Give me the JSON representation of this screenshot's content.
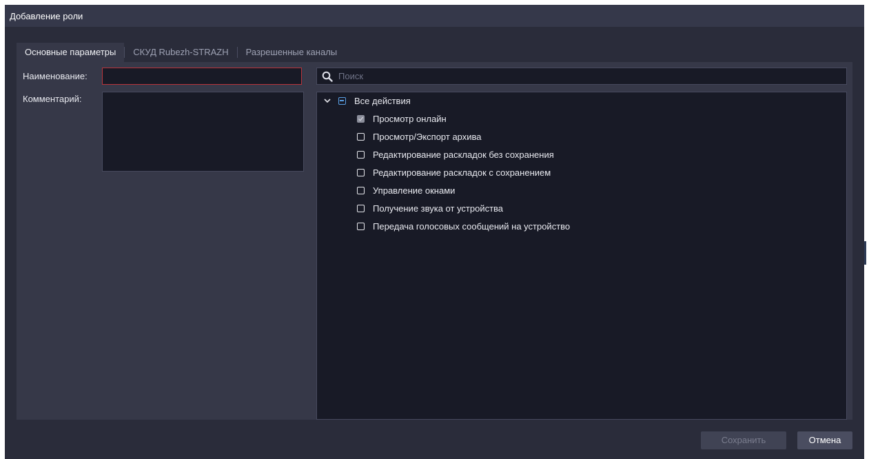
{
  "window": {
    "title": "Добавление роли"
  },
  "tabs": [
    {
      "label": "Основные параметры",
      "active": true
    },
    {
      "label": "СКУД Rubezh-STRAZH",
      "active": false
    },
    {
      "label": "Разрешенные каналы",
      "active": false
    }
  ],
  "form": {
    "name_label": "Наименование:",
    "name_value": "",
    "comment_label": "Комментарий:",
    "comment_value": ""
  },
  "search": {
    "placeholder": "Поиск",
    "icon": "search-icon"
  },
  "tree": {
    "root": {
      "label": "Все действия",
      "expanded": true,
      "state": "partial"
    },
    "items": [
      {
        "label": "Просмотр онлайн",
        "state": "checked-disabled"
      },
      {
        "label": "Просмотр/Экспорт архива",
        "state": "unchecked"
      },
      {
        "label": "Редактирование раскладок без сохранения",
        "state": "unchecked"
      },
      {
        "label": "Редактирование раскладок с сохранением",
        "state": "unchecked"
      },
      {
        "label": "Управление окнами",
        "state": "unchecked"
      },
      {
        "label": "Получение звука от устройства",
        "state": "unchecked"
      },
      {
        "label": "Передача голосовых сообщений на устройство",
        "state": "unchecked"
      }
    ]
  },
  "buttons": {
    "save_label": "Сохранить",
    "save_enabled": false,
    "cancel_label": "Отмена"
  },
  "colors": {
    "background": "#2a2c3a",
    "panel": "#363848",
    "field": "#181a26",
    "error_border": "#b9343b",
    "accent": "#5aa0e6"
  }
}
